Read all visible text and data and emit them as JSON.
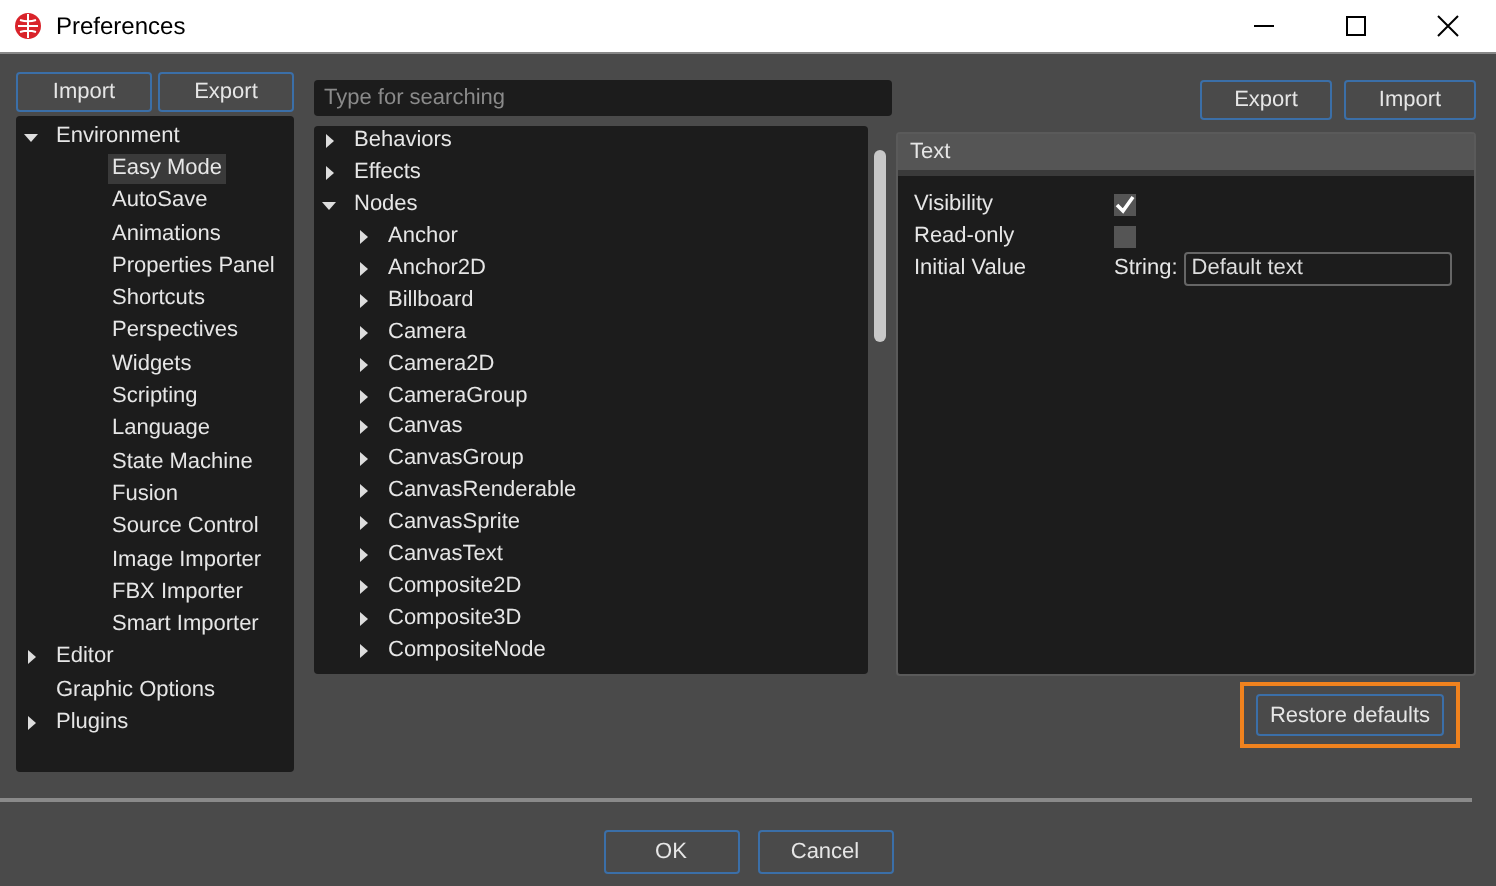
{
  "window": {
    "title": "Preferences"
  },
  "left_buttons": [
    "Import",
    "Export"
  ],
  "categories": [
    {
      "label": "Environment",
      "expanded": true,
      "selected": false,
      "children": [
        {
          "label": "Easy Mode",
          "selected": true
        },
        {
          "label": "AutoSave",
          "selected": false
        },
        {
          "label": "Animations",
          "selected": false
        },
        {
          "label": "Properties Panel",
          "selected": false
        },
        {
          "label": "Shortcuts",
          "selected": false
        },
        {
          "label": "Perspectives",
          "selected": false
        },
        {
          "label": "Widgets",
          "selected": false
        },
        {
          "label": "Scripting",
          "selected": false
        },
        {
          "label": "Language",
          "selected": false
        },
        {
          "label": "State Machine",
          "selected": false
        },
        {
          "label": "Fusion",
          "selected": false
        },
        {
          "label": "Source Control",
          "selected": false
        },
        {
          "label": "Image Importer",
          "selected": false
        },
        {
          "label": "FBX Importer",
          "selected": false
        },
        {
          "label": "Smart Importer",
          "selected": false
        }
      ]
    },
    {
      "label": "Editor",
      "expanded": false,
      "selected": false
    },
    {
      "label": "Graphic Options",
      "selected": false
    },
    {
      "label": "Plugins",
      "expanded": false,
      "selected": false
    }
  ],
  "search": {
    "placeholder": "Type for searching"
  },
  "types": [
    {
      "label": "Behaviors",
      "expanded": false
    },
    {
      "label": "Effects",
      "expanded": false
    },
    {
      "label": "Nodes",
      "expanded": true,
      "children": [
        {
          "label": "Anchor",
          "expanded": false
        },
        {
          "label": "Anchor2D",
          "expanded": false
        },
        {
          "label": "Billboard",
          "expanded": false
        },
        {
          "label": "Camera",
          "expanded": false
        },
        {
          "label": "Camera2D",
          "expanded": false
        },
        {
          "label": "CameraGroup",
          "expanded": false
        },
        {
          "label": "Canvas",
          "expanded": false
        },
        {
          "label": "CanvasGroup",
          "expanded": false
        },
        {
          "label": "CanvasRenderable",
          "expanded": false
        },
        {
          "label": "CanvasSprite",
          "expanded": false
        },
        {
          "label": "CanvasText",
          "expanded": false
        },
        {
          "label": "Composite2D",
          "expanded": false
        },
        {
          "label": "Composite3D",
          "expanded": false
        },
        {
          "label": "CompositeNode",
          "expanded": false
        }
      ]
    }
  ],
  "right_buttons": [
    "Export",
    "Import"
  ],
  "properties": {
    "title": "Text",
    "rows": [
      {
        "kind": "checkbox",
        "label": "Visibility",
        "checked": true
      },
      {
        "kind": "checkbox",
        "label": "Read-only",
        "checked": false
      },
      {
        "kind": "field",
        "label": "Initial Value",
        "prefix": "String:",
        "value": "Default text"
      }
    ]
  },
  "restore_button": {
    "label": "Restore defaults",
    "highlighted": true
  },
  "dialog_buttons": [
    "OK",
    "Cancel"
  ]
}
